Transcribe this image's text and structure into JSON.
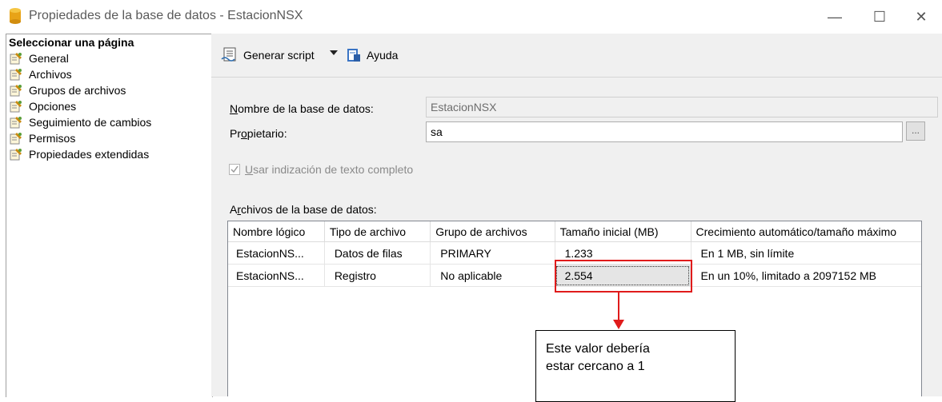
{
  "window": {
    "title": "Propiedades de la base de datos - EstacionNSX",
    "minimize": "—",
    "maximize": "☐",
    "close": "✕"
  },
  "sidebar": {
    "header": "Seleccionar una página",
    "items": [
      {
        "label": "General"
      },
      {
        "label": "Archivos"
      },
      {
        "label": "Grupos de archivos"
      },
      {
        "label": "Opciones"
      },
      {
        "label": "Seguimiento de cambios"
      },
      {
        "label": "Permisos"
      },
      {
        "label": "Propiedades extendidas"
      }
    ]
  },
  "toolbar": {
    "script_label": "Generar script",
    "help_label": "Ayuda"
  },
  "form": {
    "dbname_label_u": "N",
    "dbname_label_rest": "ombre de la base de datos:",
    "dbname_value": "EstacionNSX",
    "owner_label_pre": "Pr",
    "owner_label_u": "o",
    "owner_label_rest": "pietario:",
    "owner_value": "sa",
    "ellipsis": "...",
    "fulltext_u": "U",
    "fulltext_rest": "sar indización de texto completo"
  },
  "files": {
    "label_pre": "A",
    "label_u": "r",
    "label_rest": "chivos de la base de datos:",
    "columns": [
      "Nombre lógico",
      "Tipo de archivo",
      "Grupo de archivos",
      "Tamaño inicial (MB)",
      "Crecimiento automático/tamaño máximo"
    ],
    "rows": [
      [
        "EstacionNS...",
        "Datos de filas",
        "PRIMARY",
        "1.233",
        "En 1 MB, sin límite"
      ],
      [
        "EstacionNS...",
        "Registro",
        "No aplicable",
        "2.554",
        "En un 10%, limitado a 2097152 MB"
      ]
    ]
  },
  "annotation": {
    "text_line1": "Este valor debería",
    "text_line2": "estar cercano a 1",
    "color": "#e01b1b"
  }
}
